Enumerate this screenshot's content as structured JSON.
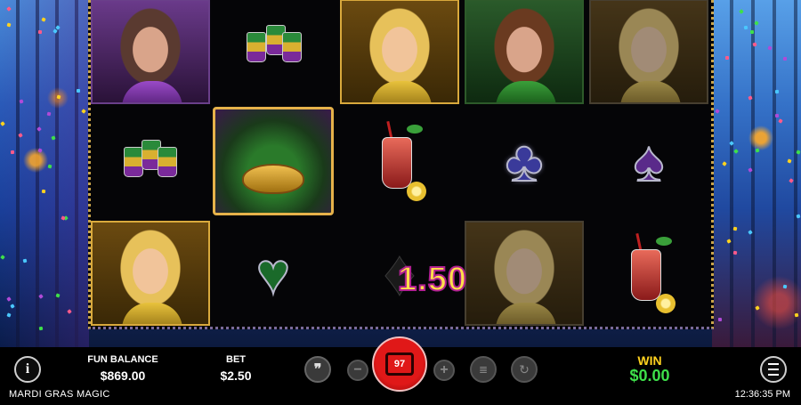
{
  "game": {
    "title": "MARDI GRAS MAGIC",
    "clock": "12:36:35 PM"
  },
  "reels": {
    "grid": [
      [
        "lady-purple",
        "drink-cups",
        "lady-gold",
        "lady-green",
        "lady-gold-dim"
      ],
      [
        "drink-cups",
        "mask-wild",
        "cocktail",
        "club",
        "spade"
      ],
      [
        "lady-gold",
        "heart",
        "diamond",
        "lady-gold-dim",
        "cocktail"
      ]
    ],
    "win_display": "1.50"
  },
  "hud": {
    "info_icon": "i",
    "balance_label": "FUN BALANCE",
    "balance_value": "$869.00",
    "bet_label": "BET",
    "bet_value": "$2.50",
    "minus": "−",
    "plus": "+",
    "spin_count": "97",
    "win_label": "WIN",
    "win_value": "$0.00"
  },
  "colors": {
    "win_gold": "#ffd21f",
    "win_green": "#3ee04a",
    "spin_red": "#e01818"
  }
}
